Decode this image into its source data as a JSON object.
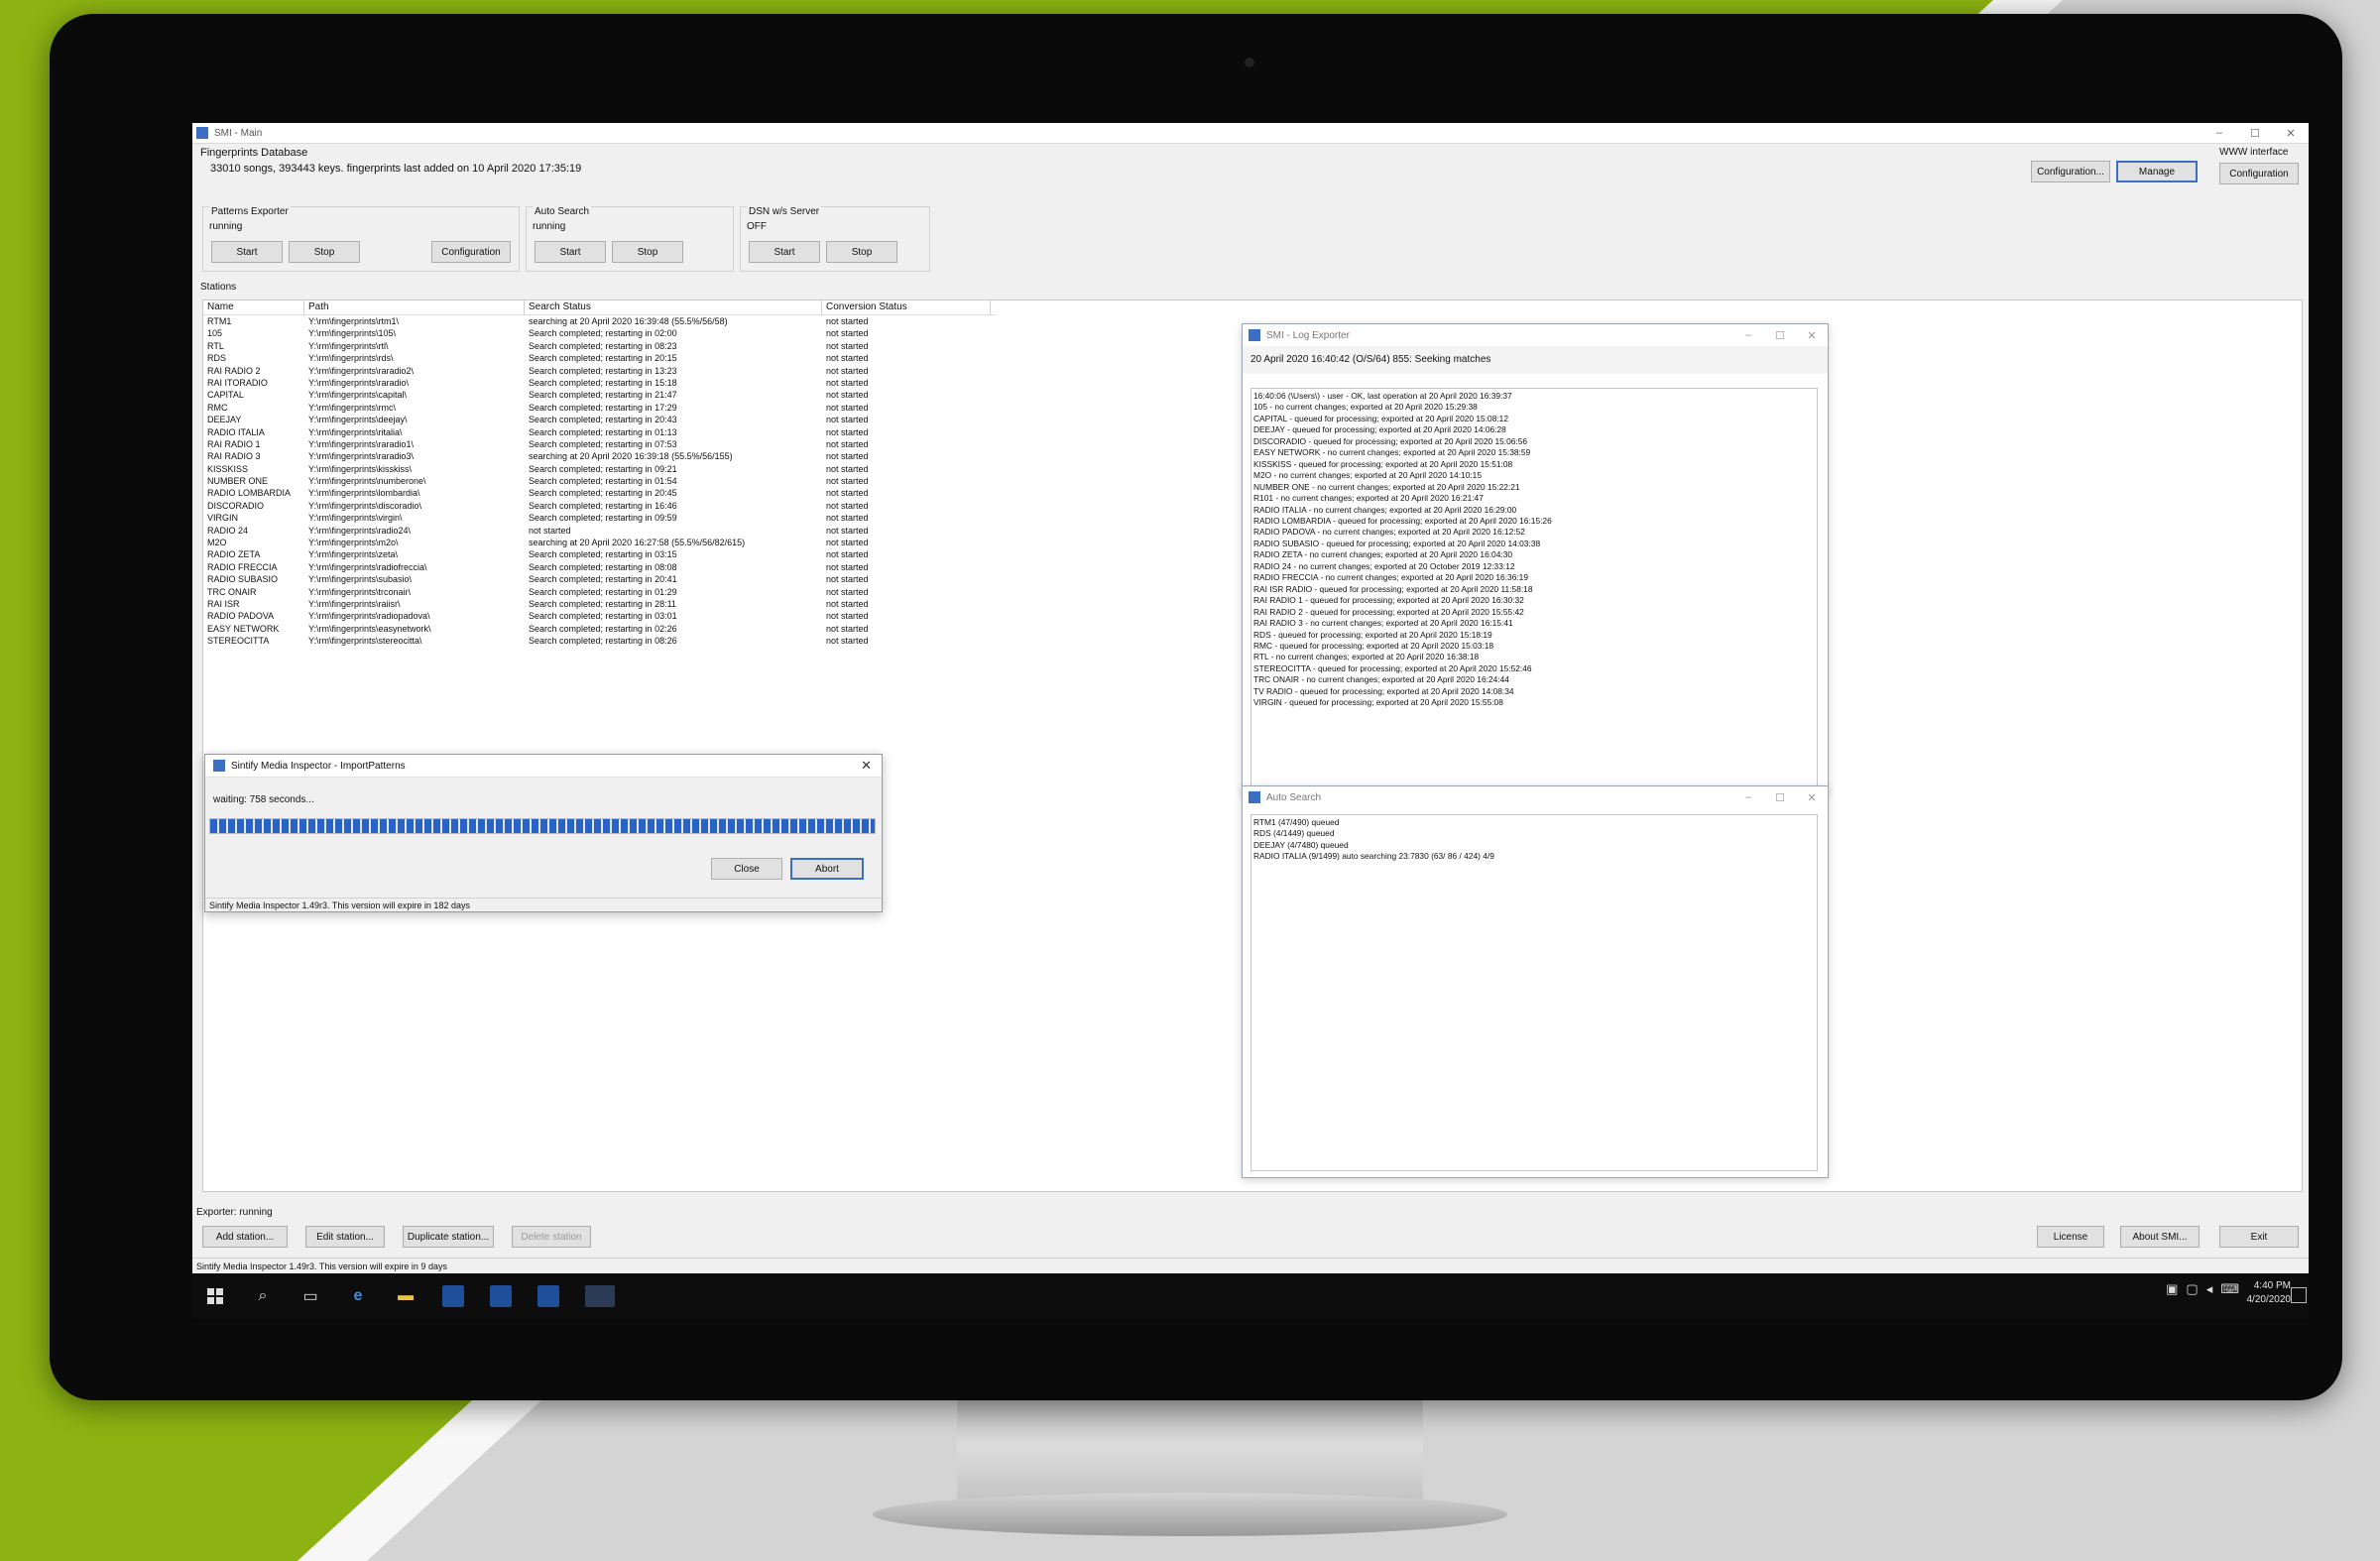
{
  "window": {
    "title": "SMI - Main"
  },
  "database": {
    "label": "Fingerprints Database",
    "info": "33010 songs, 393443 keys. fingerprints last added on 10 April 2020 17:35:19",
    "buttons": {
      "configuration": "Configuration...",
      "manage": "Manage"
    }
  },
  "www_interface": {
    "label": "WWW interface",
    "button": "Configuration"
  },
  "patterns_exporter": {
    "label": "Patterns Exporter",
    "status": "running",
    "start": "Start",
    "stop": "Stop",
    "config": "Configuration"
  },
  "auto_search": {
    "label": "Auto Search",
    "status": "running",
    "start": "Start",
    "stop": "Stop"
  },
  "dsn_server": {
    "label": "DSN w/s Server",
    "status": "OFF",
    "start": "Start",
    "stop": "Stop"
  },
  "stations": {
    "label": "Stations",
    "columns": [
      "Name",
      "Path",
      "Search Status",
      "Conversion Status"
    ],
    "rows": [
      [
        "RTM1",
        "Y:\\rm\\fingerprints\\rtm1\\",
        "searching at 20 April 2020 16:39:48 (55.5%/56/58)",
        "not started"
      ],
      [
        "105",
        "Y:\\rm\\fingerprints\\105\\",
        "Search completed; restarting in 02:00",
        "not started"
      ],
      [
        "RTL",
        "Y:\\rm\\fingerprints\\rtl\\",
        "Search completed; restarting in 08:23",
        "not started"
      ],
      [
        "RDS",
        "Y:\\rm\\fingerprints\\rds\\",
        "Search completed; restarting in 20:15",
        "not started"
      ],
      [
        "RAI RADIO 2",
        "Y:\\rm\\fingerprints\\raradio2\\",
        "Search completed; restarting in 13:23",
        "not started"
      ],
      [
        "RAI ITORADIO",
        "Y:\\rm\\fingerprints\\raradio\\",
        "Search completed; restarting in 15:18",
        "not started"
      ],
      [
        "CAPITAL",
        "Y:\\rm\\fingerprints\\capital\\",
        "Search completed; restarting in 21:47",
        "not started"
      ],
      [
        "RMC",
        "Y:\\rm\\fingerprints\\rmc\\",
        "Search completed; restarting in 17:29",
        "not started"
      ],
      [
        "DEEJAY",
        "Y:\\rm\\fingerprints\\deejay\\",
        "Search completed; restarting in 20:43",
        "not started"
      ],
      [
        "RADIO ITALIA",
        "Y:\\rm\\fingerprints\\ritalia\\",
        "Search completed; restarting in 01:13",
        "not started"
      ],
      [
        "RAI RADIO 1",
        "Y:\\rm\\fingerprints\\raradio1\\",
        "Search completed; restarting in 07:53",
        "not started"
      ],
      [
        "RAI RADIO 3",
        "Y:\\rm\\fingerprints\\raradio3\\",
        "searching at 20 April 2020 16:39:18 (55.5%/56/155)",
        "not started"
      ],
      [
        "KISSKISS",
        "Y:\\rm\\fingerprints\\kisskiss\\",
        "Search completed; restarting in 09:21",
        "not started"
      ],
      [
        "NUMBER ONE",
        "Y:\\rm\\fingerprints\\numberone\\",
        "Search completed; restarting in 01:54",
        "not started"
      ],
      [
        "RADIO LOMBARDIA",
        "Y:\\rm\\fingerprints\\lombardia\\",
        "Search completed; restarting in 20:45",
        "not started"
      ],
      [
        "DISCORADIO",
        "Y:\\rm\\fingerprints\\discoradio\\",
        "Search completed; restarting in 16:46",
        "not started"
      ],
      [
        "VIRGIN",
        "Y:\\rm\\fingerprints\\virgin\\",
        "Search completed; restarting in 09:59",
        "not started"
      ],
      [
        "RADIO 24",
        "Y:\\rm\\fingerprints\\radio24\\",
        "not started",
        "not started"
      ],
      [
        "M2O",
        "Y:\\rm\\fingerprints\\m2o\\",
        "searching at 20 April 2020 16:27:58 (55.5%/56/82/615)",
        "not started"
      ],
      [
        "RADIO ZETA",
        "Y:\\rm\\fingerprints\\zeta\\",
        "Search completed; restarting in 03:15",
        "not started"
      ],
      [
        "RADIO FRECCIA",
        "Y:\\rm\\fingerprints\\radiofreccia\\",
        "Search completed; restarting in 08:08",
        "not started"
      ],
      [
        "RADIO SUBASIO",
        "Y:\\rm\\fingerprints\\subasio\\",
        "Search completed; restarting in 20:41",
        "not started"
      ],
      [
        "TRC ONAIR",
        "Y:\\rm\\fingerprints\\trconair\\",
        "Search completed; restarting in 01:29",
        "not started"
      ],
      [
        "RAI ISR",
        "Y:\\rm\\fingerprints\\raiisr\\",
        "Search completed; restarting in 28:11",
        "not started"
      ],
      [
        "RADIO PADOVA",
        "Y:\\rm\\fingerprints\\radiopadova\\",
        "Search completed; restarting in 03:01",
        "not started"
      ],
      [
        "EASY NETWORK",
        "Y:\\rm\\fingerprints\\easynetwork\\",
        "Search completed; restarting in 02:26",
        "not started"
      ],
      [
        "STEREOCITTA",
        "Y:\\rm\\fingerprints\\stereocitta\\",
        "Search completed; restarting in 08:26",
        "not started"
      ]
    ]
  },
  "dialog": {
    "title": "Sintify Media Inspector - ImportPatterns",
    "message": "waiting: 758 seconds...",
    "progress": 1.0,
    "close": "Close",
    "abort": "Abort",
    "status": "Sintify Media Inspector 1.49r3. This version will expire in 182 days"
  },
  "log_window": {
    "title": "SMI - Log Exporter",
    "header": "20 April 2020 16:40:42 (O/S/64) 855: Seeking matches",
    "lines": [
      "16:40:06 (\\Users\\) - user - OK, last operation at 20 April 2020 16:39:37",
      "105 - no current changes; exported at 20 April 2020 15:29:38",
      "CAPITAL - queued for processing; exported at 20 April 2020 15:08:12",
      "DEEJAY - queued for processing; exported at 20 April 2020 14:06:28",
      "DISCORADIO - queued for processing; exported at 20 April 2020 15:06:56",
      "EASY NETWORK - no current changes; exported at 20 April 2020 15:38:59",
      "KISSKISS - queued for processing; exported at 20 April 2020 15:51:08",
      "M2O - no current changes; exported at 20 April 2020 14:10:15",
      "NUMBER ONE - no current changes; exported at 20 April 2020 15:22:21",
      "R101 - no current changes; exported at 20 April 2020 16:21:47",
      "RADIO ITALIA - no current changes; exported at 20 April 2020 16:29:00",
      "RADIO LOMBARDIA - queued for processing; exported at 20 April 2020 16:15:26",
      "RADIO PADOVA - no current changes; exported at 20 April 2020 16:12:52",
      "RADIO SUBASIO - queued for processing; exported at 20 April 2020 14:03:38",
      "RADIO ZETA - no current changes; exported at 20 April 2020 16:04:30",
      "RADIO 24 - no current changes; exported at 20 October 2019 12:33:12",
      "RADIO FRECCIA - no current changes; exported at 20 April 2020 16:36:19",
      "RAI ISR RADIO - queued for processing; exported at 20 April 2020 11:58:18",
      "RAI RADIO 1 - queued for processing; exported at 20 April 2020 16:30:32",
      "RAI RADIO 2 - queued for processing; exported at 20 April 2020 15:55:42",
      "RAI RADIO 3 - no current changes; exported at 20 April 2020 16:15:41",
      "RDS - queued for processing; exported at 20 April 2020 15:18:19",
      "RMC - queued for processing; exported at 20 April 2020 15:03:18",
      "RTL - no current changes; exported at 20 April 2020 16:38:18",
      "STEREOCITTA - queued for processing; exported at 20 April 2020 15:52:46",
      "TRC ONAIR - no current changes; exported at 20 April 2020 16:24:44",
      "TV RADIO - queued for processing; exported at 20 April 2020 14:08:34",
      "VIRGIN - queued for processing; exported at 20 April 2020 15:55:08"
    ]
  },
  "auto_search_window": {
    "title": "Auto Search",
    "lines": [
      "RTM1 (47/490) queued",
      "RDS (4/1449) queued",
      "DEEJAY (4/7480) queued",
      "RADIO ITALIA (9/1499) auto searching 23:7830 (63/ 86 / 424) 4/9"
    ]
  },
  "exporter": {
    "label": "Exporter: running"
  },
  "bottom_buttons": {
    "add": "Add station...",
    "edit": "Edit station...",
    "duplicate": "Duplicate station...",
    "delete": "Delete station",
    "license": "License",
    "about": "About SMI...",
    "exit": "Exit"
  },
  "statusbar": {
    "text": "Sintify Media Inspector 1.49r3. This version will expire in 9 days"
  },
  "taskbar": {
    "icons": [
      "windows-icon",
      "search-icon",
      "task-view-icon",
      "edge-icon",
      "file-explorer-icon",
      "app-icon",
      "app-icon",
      "app-icon",
      "app-icon"
    ],
    "clock_time": "4:40 PM",
    "clock_date": "4/20/2020"
  },
  "colors": {
    "accent_green": "#8cb312",
    "progress": "#2a63c8",
    "taskbar": "#0d0d0d"
  }
}
